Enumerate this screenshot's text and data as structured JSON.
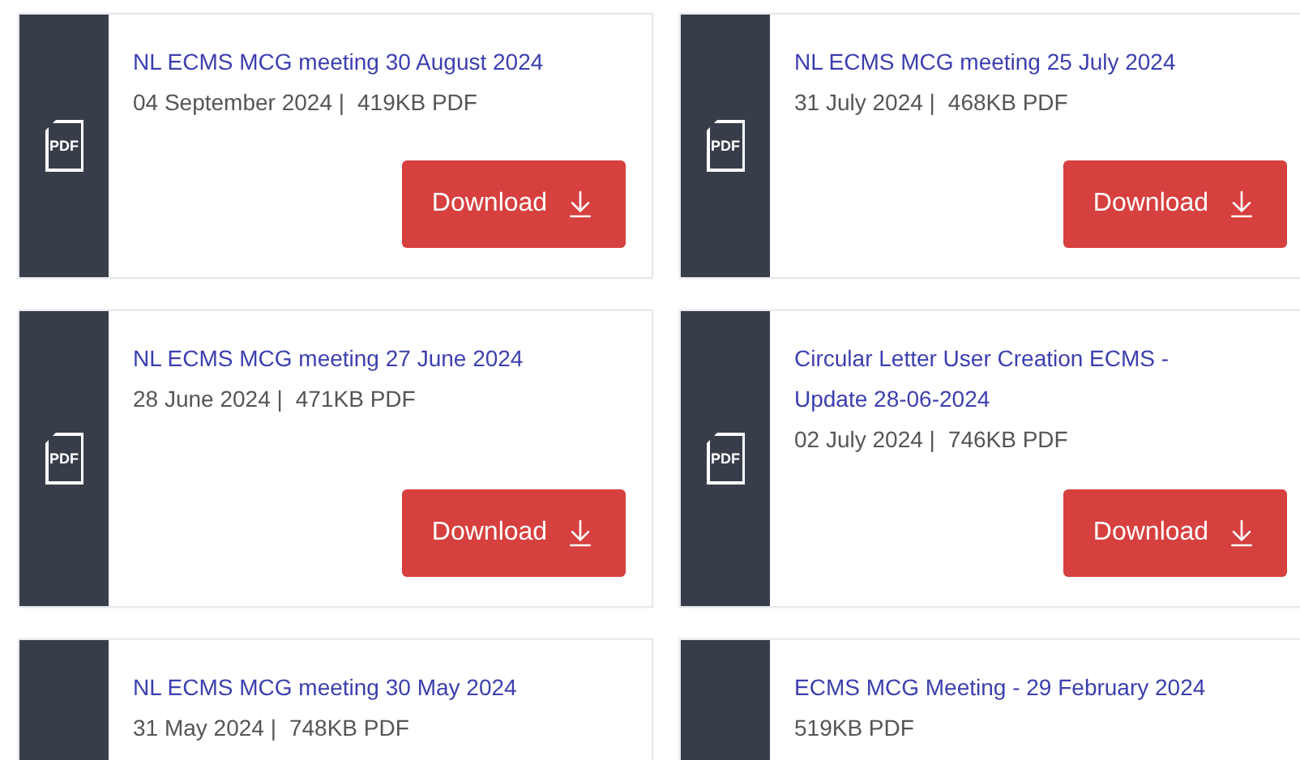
{
  "documents": [
    {
      "file_badge": "PDF",
      "title": "NL ECMS MCG meeting 30 August 2024",
      "date": "04 September 2024 |",
      "size": "419KB PDF",
      "button": "Download"
    },
    {
      "file_badge": "PDF",
      "title": "NL ECMS MCG meeting 25 July 2024",
      "date": "31 July 2024 |",
      "size": "468KB PDF",
      "button": "Download"
    },
    {
      "file_badge": "PDF",
      "title": "NL ECMS MCG meeting 27 June 2024",
      "date": "28 June 2024 |",
      "size": "471KB PDF",
      "button": "Download"
    },
    {
      "file_badge": "PDF",
      "title": "Circular Letter User Creation ECMS - Update 28-06-2024",
      "date": "02 July 2024 |",
      "size": "746KB PDF",
      "button": "Download"
    },
    {
      "title": "NL ECMS MCG meeting 30 May 2024",
      "date": "31 May 2024 |",
      "size": "748KB PDF"
    },
    {
      "title": "ECMS MCG Meeting - 29 February 2024",
      "size": "519KB PDF"
    }
  ]
}
